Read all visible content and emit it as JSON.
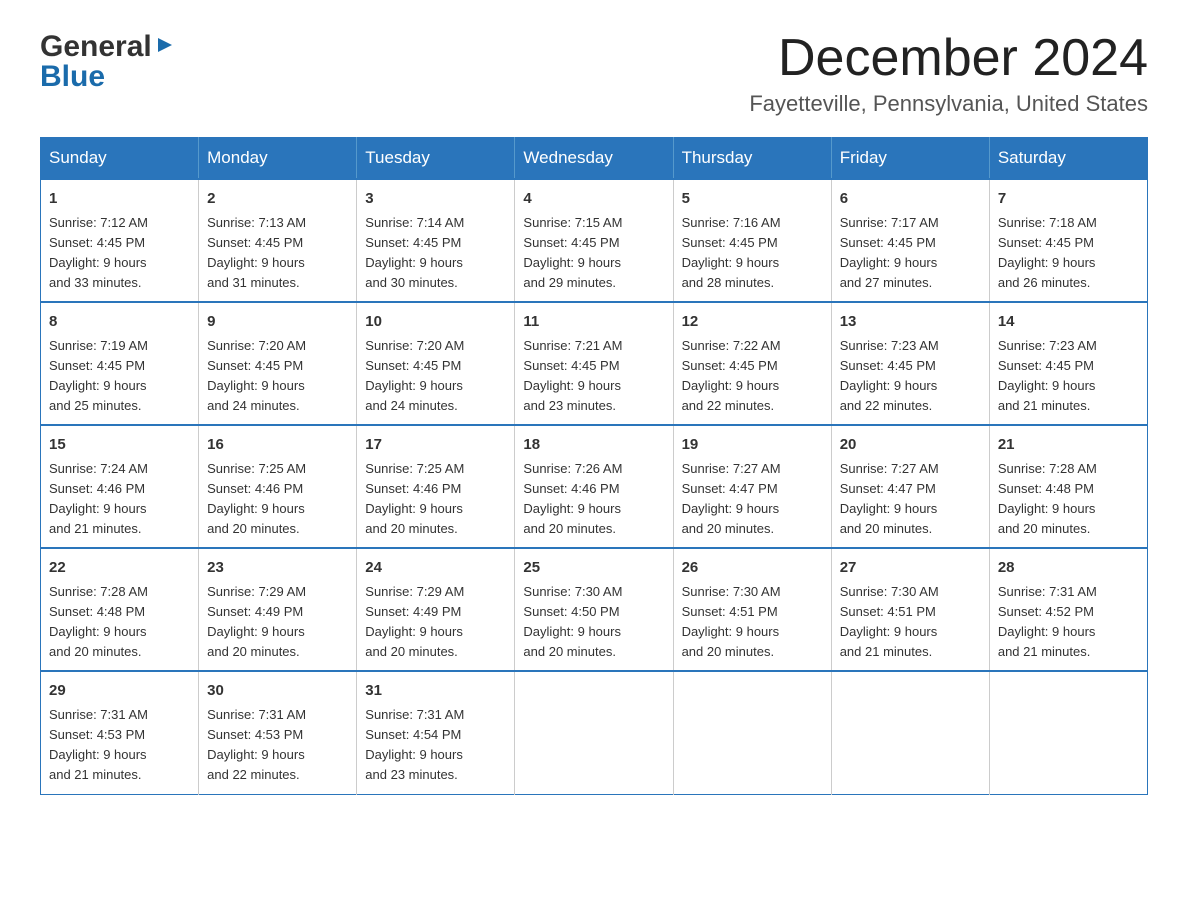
{
  "logo": {
    "text_general": "General",
    "text_blue": "Blue",
    "arrow_symbol": "▶"
  },
  "title": "December 2024",
  "subtitle": "Fayetteville, Pennsylvania, United States",
  "days_header": [
    "Sunday",
    "Monday",
    "Tuesday",
    "Wednesday",
    "Thursday",
    "Friday",
    "Saturday"
  ],
  "weeks": [
    [
      {
        "day": "1",
        "sunrise": "7:12 AM",
        "sunset": "4:45 PM",
        "daylight": "9 hours and 33 minutes."
      },
      {
        "day": "2",
        "sunrise": "7:13 AM",
        "sunset": "4:45 PM",
        "daylight": "9 hours and 31 minutes."
      },
      {
        "day": "3",
        "sunrise": "7:14 AM",
        "sunset": "4:45 PM",
        "daylight": "9 hours and 30 minutes."
      },
      {
        "day": "4",
        "sunrise": "7:15 AM",
        "sunset": "4:45 PM",
        "daylight": "9 hours and 29 minutes."
      },
      {
        "day": "5",
        "sunrise": "7:16 AM",
        "sunset": "4:45 PM",
        "daylight": "9 hours and 28 minutes."
      },
      {
        "day": "6",
        "sunrise": "7:17 AM",
        "sunset": "4:45 PM",
        "daylight": "9 hours and 27 minutes."
      },
      {
        "day": "7",
        "sunrise": "7:18 AM",
        "sunset": "4:45 PM",
        "daylight": "9 hours and 26 minutes."
      }
    ],
    [
      {
        "day": "8",
        "sunrise": "7:19 AM",
        "sunset": "4:45 PM",
        "daylight": "9 hours and 25 minutes."
      },
      {
        "day": "9",
        "sunrise": "7:20 AM",
        "sunset": "4:45 PM",
        "daylight": "9 hours and 24 minutes."
      },
      {
        "day": "10",
        "sunrise": "7:20 AM",
        "sunset": "4:45 PM",
        "daylight": "9 hours and 24 minutes."
      },
      {
        "day": "11",
        "sunrise": "7:21 AM",
        "sunset": "4:45 PM",
        "daylight": "9 hours and 23 minutes."
      },
      {
        "day": "12",
        "sunrise": "7:22 AM",
        "sunset": "4:45 PM",
        "daylight": "9 hours and 22 minutes."
      },
      {
        "day": "13",
        "sunrise": "7:23 AM",
        "sunset": "4:45 PM",
        "daylight": "9 hours and 22 minutes."
      },
      {
        "day": "14",
        "sunrise": "7:23 AM",
        "sunset": "4:45 PM",
        "daylight": "9 hours and 21 minutes."
      }
    ],
    [
      {
        "day": "15",
        "sunrise": "7:24 AM",
        "sunset": "4:46 PM",
        "daylight": "9 hours and 21 minutes."
      },
      {
        "day": "16",
        "sunrise": "7:25 AM",
        "sunset": "4:46 PM",
        "daylight": "9 hours and 20 minutes."
      },
      {
        "day": "17",
        "sunrise": "7:25 AM",
        "sunset": "4:46 PM",
        "daylight": "9 hours and 20 minutes."
      },
      {
        "day": "18",
        "sunrise": "7:26 AM",
        "sunset": "4:46 PM",
        "daylight": "9 hours and 20 minutes."
      },
      {
        "day": "19",
        "sunrise": "7:27 AM",
        "sunset": "4:47 PM",
        "daylight": "9 hours and 20 minutes."
      },
      {
        "day": "20",
        "sunrise": "7:27 AM",
        "sunset": "4:47 PM",
        "daylight": "9 hours and 20 minutes."
      },
      {
        "day": "21",
        "sunrise": "7:28 AM",
        "sunset": "4:48 PM",
        "daylight": "9 hours and 20 minutes."
      }
    ],
    [
      {
        "day": "22",
        "sunrise": "7:28 AM",
        "sunset": "4:48 PM",
        "daylight": "9 hours and 20 minutes."
      },
      {
        "day": "23",
        "sunrise": "7:29 AM",
        "sunset": "4:49 PM",
        "daylight": "9 hours and 20 minutes."
      },
      {
        "day": "24",
        "sunrise": "7:29 AM",
        "sunset": "4:49 PM",
        "daylight": "9 hours and 20 minutes."
      },
      {
        "day": "25",
        "sunrise": "7:30 AM",
        "sunset": "4:50 PM",
        "daylight": "9 hours and 20 minutes."
      },
      {
        "day": "26",
        "sunrise": "7:30 AM",
        "sunset": "4:51 PM",
        "daylight": "9 hours and 20 minutes."
      },
      {
        "day": "27",
        "sunrise": "7:30 AM",
        "sunset": "4:51 PM",
        "daylight": "9 hours and 21 minutes."
      },
      {
        "day": "28",
        "sunrise": "7:31 AM",
        "sunset": "4:52 PM",
        "daylight": "9 hours and 21 minutes."
      }
    ],
    [
      {
        "day": "29",
        "sunrise": "7:31 AM",
        "sunset": "4:53 PM",
        "daylight": "9 hours and 21 minutes."
      },
      {
        "day": "30",
        "sunrise": "7:31 AM",
        "sunset": "4:53 PM",
        "daylight": "9 hours and 22 minutes."
      },
      {
        "day": "31",
        "sunrise": "7:31 AM",
        "sunset": "4:54 PM",
        "daylight": "9 hours and 23 minutes."
      },
      null,
      null,
      null,
      null
    ]
  ],
  "labels": {
    "sunrise": "Sunrise:",
    "sunset": "Sunset:",
    "daylight": "Daylight:"
  }
}
